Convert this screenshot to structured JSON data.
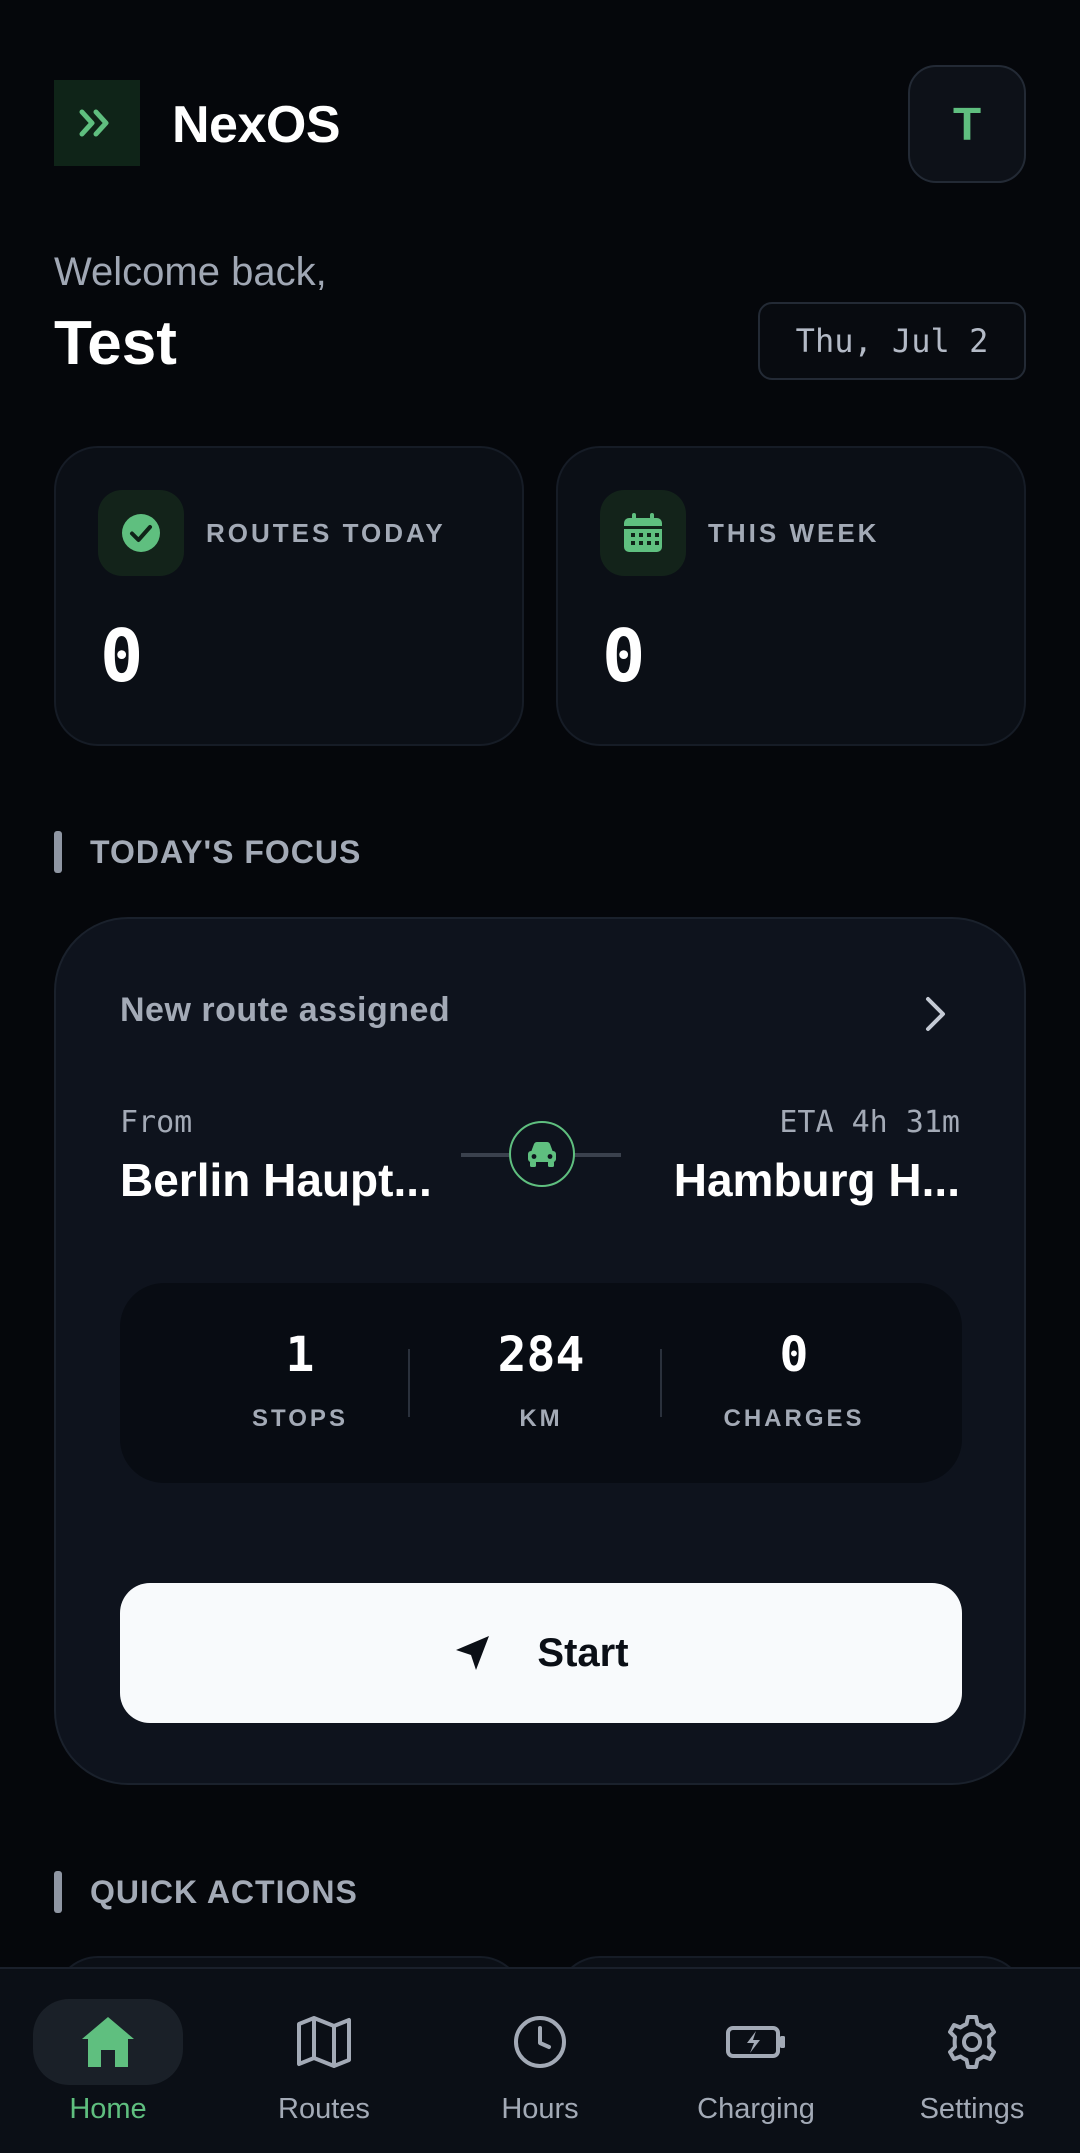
{
  "header": {
    "brand": "NexOS",
    "avatar_initial": "T"
  },
  "welcome": {
    "greeting": "Welcome back,",
    "name": "Test",
    "date": "Thu, Jul 2"
  },
  "stats": [
    {
      "label": "ROUTES TODAY",
      "value": "0",
      "icon": "check-circle-icon"
    },
    {
      "label": "THIS WEEK",
      "value": "0",
      "icon": "calendar-icon"
    }
  ],
  "focus": {
    "section_title": "TODAY'S FOCUS",
    "heading": "New route assigned",
    "from_label": "From",
    "from_value": "Berlin Haupt...",
    "eta_label": "ETA 4h 31m",
    "to_value": "Hamburg H...",
    "metrics": [
      {
        "value": "1",
        "label": "STOPS"
      },
      {
        "value": "284",
        "label": "KM"
      },
      {
        "value": "0",
        "label": "CHARGES"
      }
    ],
    "start_label": "Start"
  },
  "quick_actions": {
    "section_title": "QUICK ACTIONS"
  },
  "nav": [
    {
      "label": "Home",
      "icon": "home-icon",
      "active": true
    },
    {
      "label": "Routes",
      "icon": "map-icon",
      "active": false
    },
    {
      "label": "Hours",
      "icon": "clock-icon",
      "active": false
    },
    {
      "label": "Charging",
      "icon": "battery-charging-icon",
      "active": false
    },
    {
      "label": "Settings",
      "icon": "gear-icon",
      "active": false
    }
  ],
  "colors": {
    "accent": "#5fbf7f",
    "background": "#05070b",
    "card": "#0e131d"
  }
}
